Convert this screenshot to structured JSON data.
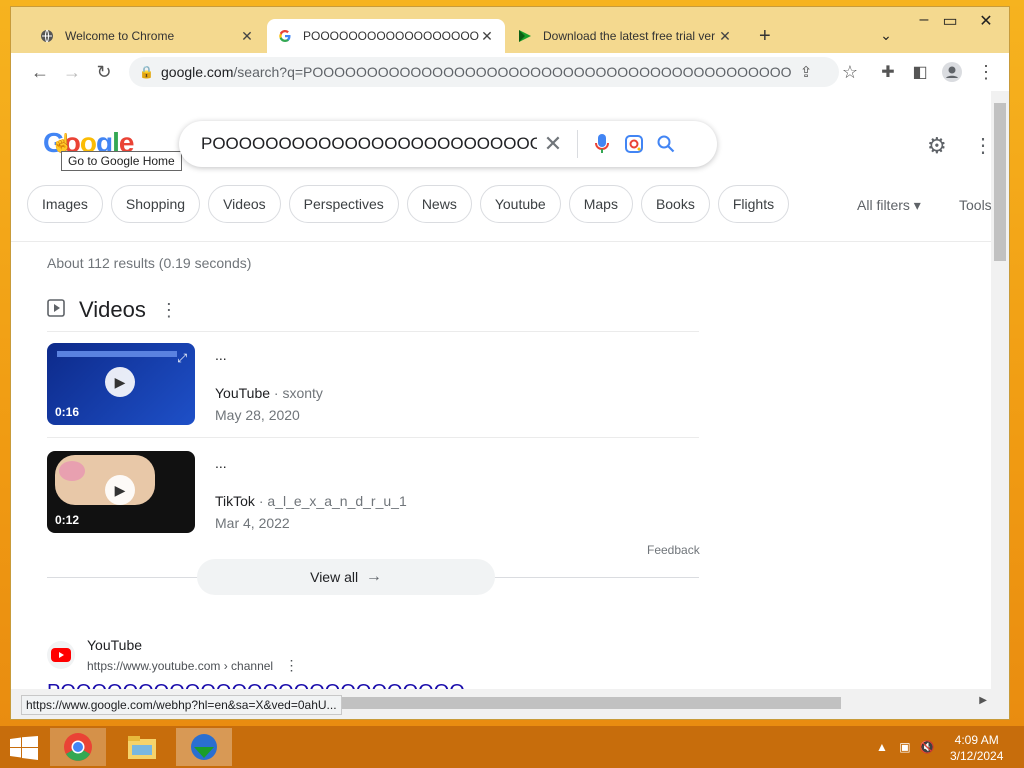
{
  "browser": {
    "tabs": [
      {
        "label": "Welcome to Chrome",
        "icon": "globe-icon"
      },
      {
        "label": "POOOOOOOOOOOOOOOOOOOOOOOOOOOOOOOOO",
        "icon": "google-icon",
        "active": true
      },
      {
        "label": "Download the latest free trial ver",
        "icon": "idm-icon"
      }
    ],
    "new_tab_label": "+",
    "url_host": "google.com",
    "url_rest": "/search?q=POOOOOOOOOOOOOOOOOOOOOOOOOOOOOOOOOOOOOOOOOOOOOOOOOOOOOOOO..."
  },
  "google": {
    "logo": "Google",
    "tooltip": "Go to Google Home",
    "query": "POOOOOOOOOOOOOOOOOOOOOOOOOOOOOOOOOOOOOO",
    "chips": [
      "Images",
      "Shopping",
      "Videos",
      "Perspectives",
      "News",
      "Youtube",
      "Maps",
      "Books",
      "Flights"
    ],
    "all_filters": "All filters",
    "tools": "Tools",
    "stats": "About 112 results (0.19 seconds)",
    "videos_heading": "Videos",
    "videos": [
      {
        "title": "...",
        "source": "YouTube",
        "author": "sxonty",
        "date": "May 28, 2020",
        "duration": "0:16"
      },
      {
        "title": "...",
        "source": "TikTok",
        "author": "a_l_e_x_a_n_d_r_u_1",
        "date": "Mar 4, 2022",
        "duration": "0:12"
      }
    ],
    "feedback": "Feedback",
    "view_all": "View all",
    "result": {
      "site": "YouTube",
      "url": "https://www.youtube.com › channel",
      "title": "POOOOOOOOOOOOOOOOOOOOOOOOOO"
    }
  },
  "status_url": "https://www.google.com/webhp?hl=en&sa=X&ved=0ahU...",
  "taskbar": {
    "time": "4:09 AM",
    "date": "3/12/2024"
  },
  "colors": {
    "accent": "#1a73e8",
    "link": "#1a0dab",
    "taskbar": "#c76d0c"
  }
}
